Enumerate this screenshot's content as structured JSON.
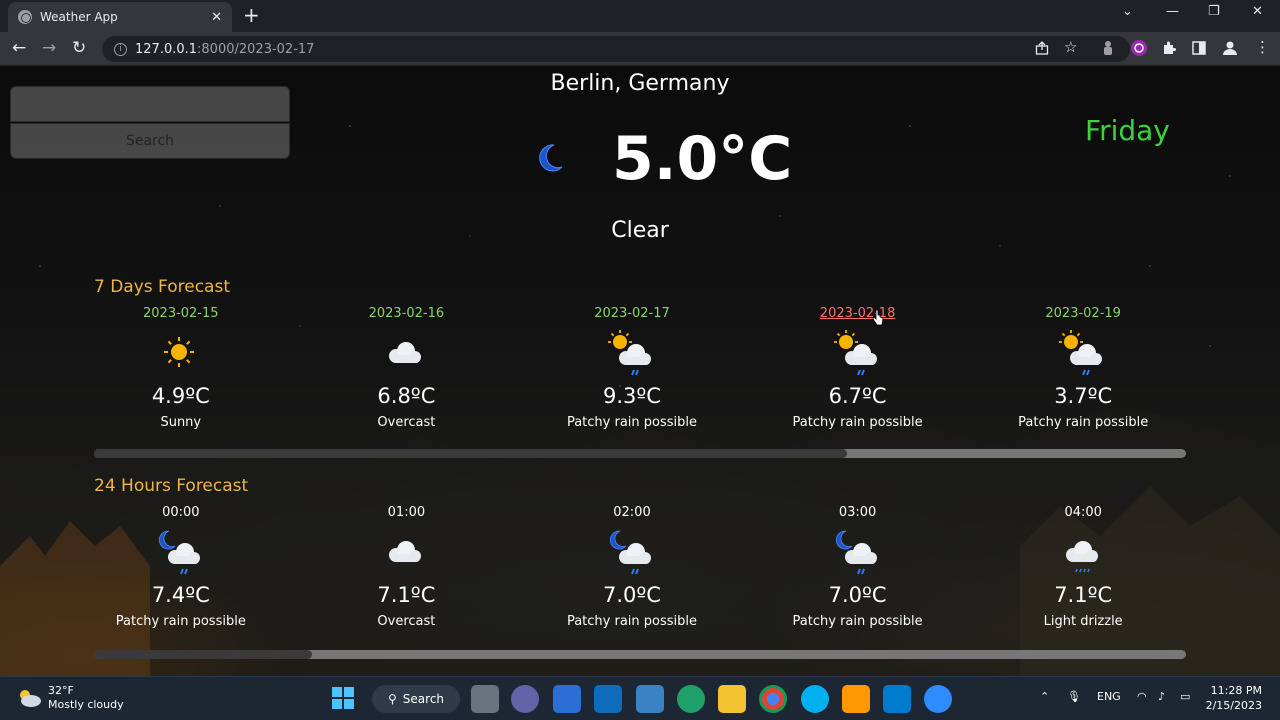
{
  "browser": {
    "tab_title": "Weather App",
    "url_host": "127.0.0.1",
    "url_rest": ":8000/2023-02-17"
  },
  "search": {
    "input_value": "",
    "button_label": "Search"
  },
  "current": {
    "location": "Berlin, Germany",
    "temperature": "5.0°C",
    "condition": "Clear",
    "day": "Friday",
    "icon": "moon-icon"
  },
  "daily": {
    "title": "7 Days Forecast",
    "items": [
      {
        "date": "2023-02-15",
        "temp": "4.9ºC",
        "condition": "Sunny",
        "icon": "sun-icon"
      },
      {
        "date": "2023-02-16",
        "temp": "6.8ºC",
        "condition": "Overcast",
        "icon": "cloud-icon"
      },
      {
        "date": "2023-02-17",
        "temp": "9.3ºC",
        "condition": "Patchy rain possible",
        "icon": "sun-cloud-rain-icon"
      },
      {
        "date": "2023-02-18",
        "temp": "6.7ºC",
        "condition": "Patchy rain possible",
        "icon": "sun-cloud-rain-icon"
      },
      {
        "date": "2023-02-19",
        "temp": "3.7ºC",
        "condition": "Patchy rain possible",
        "icon": "sun-cloud-rain-icon"
      }
    ],
    "scroll_position": 0.69
  },
  "hourly": {
    "title": "24 Hours Forecast",
    "items": [
      {
        "time": "00:00",
        "temp": "7.4ºC",
        "condition": "Patchy rain possible",
        "icon": "moon-cloud-rain-icon"
      },
      {
        "time": "01:00",
        "temp": "7.1ºC",
        "condition": "Overcast",
        "icon": "cloud-icon"
      },
      {
        "time": "02:00",
        "temp": "7.0ºC",
        "condition": "Patchy rain possible",
        "icon": "moon-cloud-rain-icon"
      },
      {
        "time": "03:00",
        "temp": "7.0ºC",
        "condition": "Patchy rain possible",
        "icon": "moon-cloud-rain-icon"
      },
      {
        "time": "04:00",
        "temp": "7.1ºC",
        "condition": "Light drizzle",
        "icon": "cloud-drizzle-icon"
      }
    ],
    "scroll_position": 0.2
  },
  "taskbar": {
    "weather_temp": "32°F",
    "weather_desc": "Mostly cloudy",
    "search_label": "Search",
    "language": "ENG",
    "time": "11:28 PM",
    "date": "2/15/2023"
  },
  "colors": {
    "accent_title": "#f0b63f",
    "date_green": "#8bd46b",
    "date_hover": "#ff6d6d",
    "day_green": "#3bd33b"
  }
}
